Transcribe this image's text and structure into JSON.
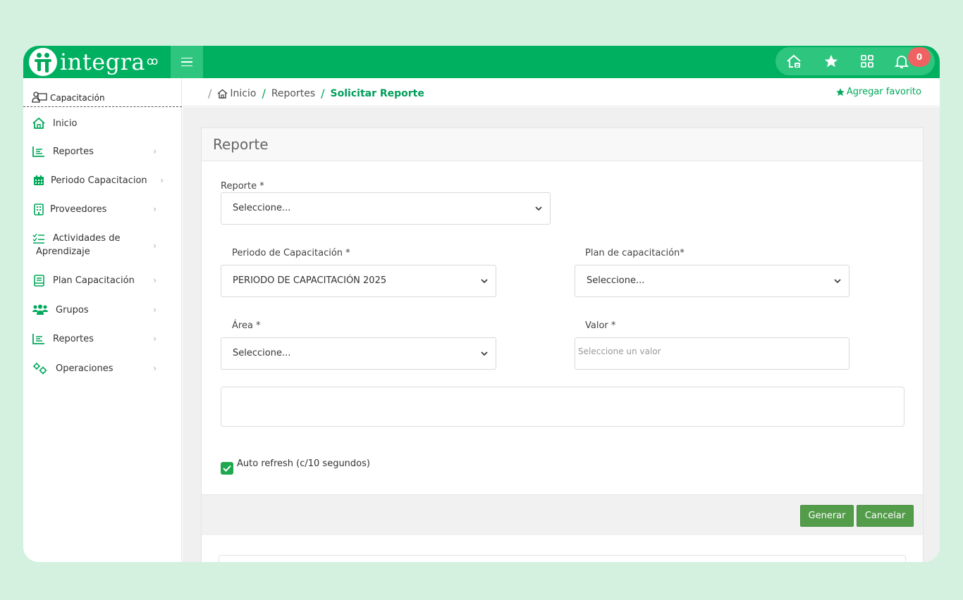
{
  "app": {
    "logo_text": "integra",
    "logo_sup": "ꝏ",
    "notification_count": "0"
  },
  "breadcrumb": {
    "items": [
      "Inicio",
      "Reportes",
      "Solicitar Reporte"
    ],
    "favorite_label": "Agregar favorito"
  },
  "sidebar": {
    "header": "Capacitación",
    "items": [
      {
        "label": "Inicio",
        "icon": "home-icon"
      },
      {
        "label": "Reportes",
        "icon": "chart-icon"
      },
      {
        "label": "Periodo Capacitacion",
        "icon": "calendar-icon"
      },
      {
        "label": "Proveedores",
        "icon": "building-icon"
      },
      {
        "label": "Actividades de",
        "label2": "Aprendizaje",
        "icon": "checklist-icon"
      },
      {
        "label": "Plan Capacitación",
        "icon": "book-icon"
      },
      {
        "label": "Grupos",
        "icon": "users-icon"
      },
      {
        "label": "Reportes",
        "icon": "chart-icon"
      },
      {
        "label": "Operaciones",
        "icon": "gears-icon"
      }
    ]
  },
  "form": {
    "title": "Reporte",
    "reporte_label": "Reporte *",
    "reporte_value": "Seleccione...",
    "periodo_label": "Periodo de Capacitación *",
    "periodo_value": "PERIODO DE CAPACITACIÓN 2025",
    "plan_label": "Plan de capacitación*",
    "plan_value": "Seleccione...",
    "area_label": "Área *",
    "area_value": "Seleccione...",
    "valor_label": "Valor *",
    "valor_placeholder": "Seleccione un valor",
    "auto_refresh_label": "Auto refresh (c/10 segundos)",
    "auto_refresh_checked": true,
    "generar_label": "Generar",
    "cancelar_label": "Cancelar"
  },
  "colors": {
    "brand": "#00b061",
    "button": "#529c4a",
    "badge": "#f06262"
  }
}
